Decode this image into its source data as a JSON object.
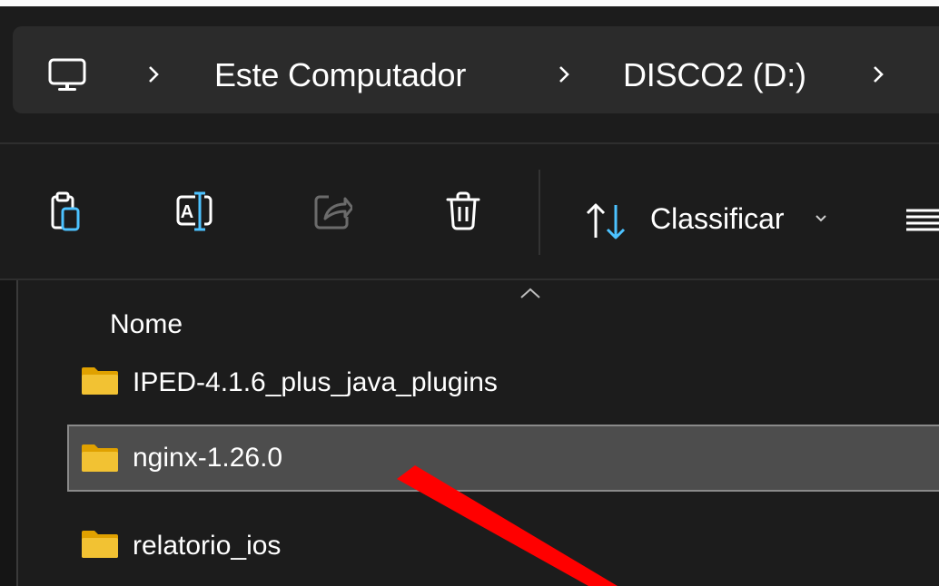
{
  "breadcrumb": {
    "root_icon": "computer-icon",
    "items": [
      {
        "label": "Este Computador"
      },
      {
        "label": "DISCO2 (D:)"
      }
    ]
  },
  "toolbar": {
    "buttons": [
      {
        "name": "paste",
        "icon": "clipboard-icon"
      },
      {
        "name": "rename",
        "icon": "rename-icon"
      },
      {
        "name": "share",
        "icon": "share-icon"
      },
      {
        "name": "delete",
        "icon": "trash-icon"
      }
    ],
    "sort_label": "Classificar",
    "view_icon": "view-lines-icon"
  },
  "list": {
    "column_header": "Nome",
    "rows": [
      {
        "name": "IPED-4.1.6_plus_java_plugins",
        "icon": "folder-icon",
        "selected": false
      },
      {
        "name": "nginx-1.26.0",
        "icon": "folder-icon",
        "selected": true
      },
      {
        "name": "relatorio_ios",
        "icon": "folder-icon",
        "selected": false
      }
    ]
  },
  "colors": {
    "background": "#1c1c1c",
    "address_bar": "#2b2b2b",
    "selected_row": "#4d4d4d",
    "folder": "#f2c233",
    "accent": "#4cc2ff",
    "annotation_arrow": "#ff0000"
  }
}
